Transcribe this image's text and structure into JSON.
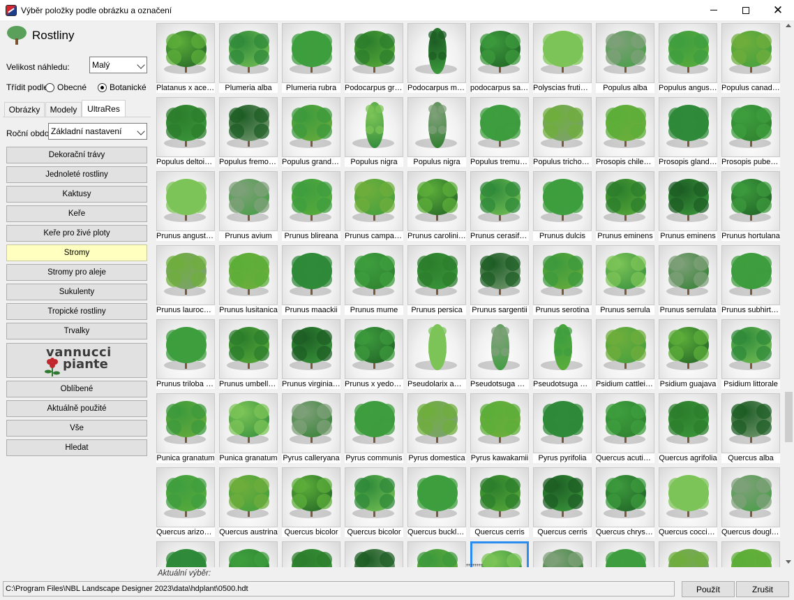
{
  "window": {
    "title": "Výběr položky podle obrázku a označení"
  },
  "category": {
    "title": "Rostliny",
    "icon": "tree-icon"
  },
  "preview_size": {
    "label": "Velikost náhledu:",
    "value": "Malý"
  },
  "sort": {
    "label": "Třídit podle",
    "options": [
      "Obecné",
      "Botanické"
    ],
    "selected": "Botanické"
  },
  "tabs": [
    "Obrázky",
    "Modely",
    "UltraRes"
  ],
  "active_tab": "UltraRes",
  "season": {
    "label": "Roční období",
    "value": "Základní nastavení"
  },
  "categories": [
    "Dekorační trávy",
    "Jednoleté rostliny",
    "Kaktusy",
    "Keře",
    "Keře pro živé ploty",
    "Stromy",
    "Stromy pro aleje",
    "Sukulenty",
    "Tropické rostliny",
    "Trvalky"
  ],
  "active_category": "Stromy",
  "vannucci": {
    "line1": "vannucci",
    "line2": "piante"
  },
  "extra_buttons": [
    "Oblíbené",
    "Aktuálně použité",
    "Vše",
    "Hledat"
  ],
  "plants": [
    [
      "Platanus x acerifolia",
      "Plumeria alba",
      "Plumeria rubra",
      "Podocarpus gracilior",
      "Podocarpus macrophyllus",
      "podocarpus salignus",
      "Polyscias fruticosa",
      "Populus alba",
      "Populus angustifolia",
      "Populus canadensis"
    ],
    [
      "Populus deltoides",
      "Populus fremontii",
      "Populus grandidentata",
      "Populus nigra",
      "Populus nigra",
      "Populus tremuloides",
      "Populus trichocarpa",
      "Prosopis chilensis",
      "Prosopis glandulosa",
      "Prosopis pubescens"
    ],
    [
      "Prunus angustifolia",
      "Prunus avium",
      "Prunus blireana",
      "Prunus campanulata",
      "Prunus caroliniana",
      "Prunus cerasifera",
      "Prunus dulcis",
      "Prunus eminens",
      "Prunus eminens",
      "Prunus hortulana"
    ],
    [
      "Prunus laurocerasus",
      "Prunus lusitanica",
      "Prunus maackii",
      "Prunus mume",
      "Prunus persica",
      "Prunus sargentii",
      "Prunus serotina",
      "Prunus serrula",
      "Prunus serrulata",
      "Prunus subhirtella"
    ],
    [
      "Prunus triloba 'Multiplex'",
      "Prunus umbellata",
      "Prunus virginiana",
      "Prunus x yedoensis",
      "Pseudolarix amabilis",
      "Pseudotsuga menziesii",
      "Pseudotsuga menziesii",
      "Psidium cattleianum",
      "Psidium guajava",
      "Psidium littorale"
    ],
    [
      "Punica granatum",
      "Punica granatum",
      "Pyrus calleryana",
      "Pyrus communis",
      "Pyrus domestica",
      "Pyrus kawakamii",
      "Pyrus pyrifolia",
      "Quercus acutissima",
      "Quercus agrifolia",
      "Quercus alba"
    ],
    [
      "Quercus arizonica",
      "Quercus austrina",
      "Quercus bicolor",
      "Quercus bicolor",
      "Quercus buckleyi",
      "Quercus cerris",
      "Quercus cerris",
      "Quercus chrysolepis",
      "Quercus coccinea",
      "Quercus douglasii"
    ]
  ],
  "colors": {
    "foliage": [
      "#5cae3a",
      "#2f8a3a",
      "#3e9e3e",
      "#2c7d2c",
      "#1d5d24",
      "#3c9a3c",
      "#7cc457",
      "#7fa07a",
      "#3f9e3f",
      "#6fae3c"
    ],
    "active_category": "#ffffc0",
    "selection": "#2b8cf0"
  },
  "current_selection": {
    "label": "Aktuální výběr:"
  },
  "path": "C:\\Program Files\\NBL Landscape Designer 2023\\data\\hdplant\\0500.hdt",
  "buttons": {
    "apply": "Použít",
    "cancel": "Zrušit"
  }
}
